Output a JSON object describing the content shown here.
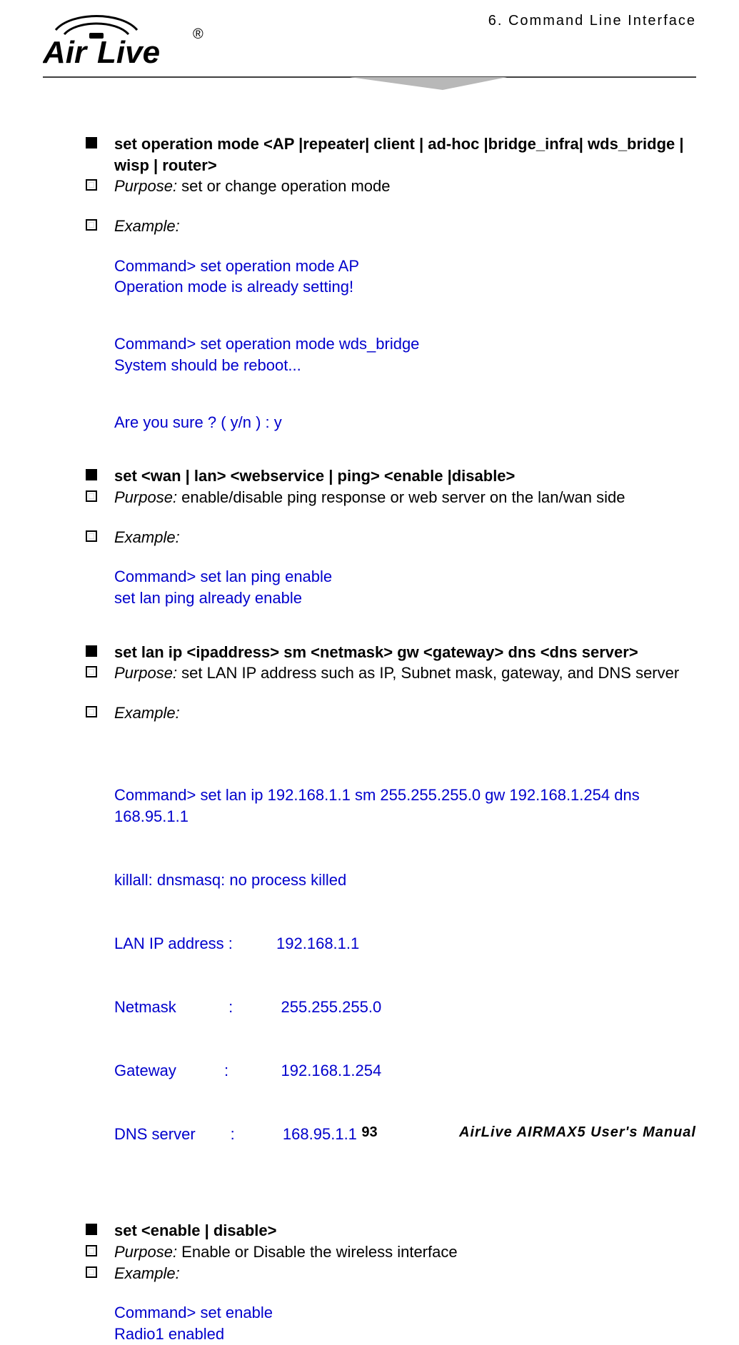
{
  "header": {
    "brand_top": "Air",
    "brand_bottom": "Live",
    "chapter": "6.   Command  Line  Interface"
  },
  "s1": {
    "title": "set operation mode <AP |repeater| client | ad-hoc |bridge_infra| wds_bridge | wisp | router>",
    "purpose_label": "Purpose:",
    "purpose_text": "   set or change operation mode",
    "example_label": "Example:",
    "ex_l1": "Command> set operation mode AP",
    "ex_l2": "Operation mode is already setting!",
    "ex_l3": "Command> set operation mode wds_bridge",
    "ex_l4": "System should be reboot...",
    "ex_l5": "Are you sure ? ( y/n ) : y"
  },
  "s2": {
    "title": "set <wan | lan> <webservice | ping> <enable |disable>",
    "purpose_label": "Purpose:",
    "purpose_text": "   enable/disable ping response or web server on the lan/wan side",
    "example_label": "Example:",
    "ex_l1": "Command> set lan ping enable",
    "ex_l2": "set lan ping already enable"
  },
  "s3": {
    "title": "set lan ip <ipaddress> sm <netmask> gw <gateway> dns <dns server>",
    "purpose_label": "Purpose:",
    "purpose_text": " set LAN IP address such as IP, Subnet mask, gateway, and DNS server",
    "example_label": "Example:",
    "ex_l1": "Command> set lan ip 192.168.1.1 sm 255.255.255.0 gw 192.168.1.254 dns 168.95.1.1",
    "ex_l2": "killall: dnsmasq: no process killed",
    "ex_l3": "LAN IP address :          192.168.1.1",
    "ex_l4": "Netmask            :           255.255.255.0",
    "ex_l5": "Gateway           :            192.168.1.254",
    "ex_l6": "DNS server        :           168.95.1.1"
  },
  "s4": {
    "title": "set <enable | disable>",
    "purpose_label": "Purpose:",
    "purpose_text": "   Enable or Disable the wireless interface",
    "example_label": "Example:",
    "ex_l1": "Command> set enable",
    "ex_l2": "Radio1 enabled"
  },
  "footer": {
    "page": "93",
    "manual": "AirLive  AIRMAX5  User's  Manual"
  }
}
